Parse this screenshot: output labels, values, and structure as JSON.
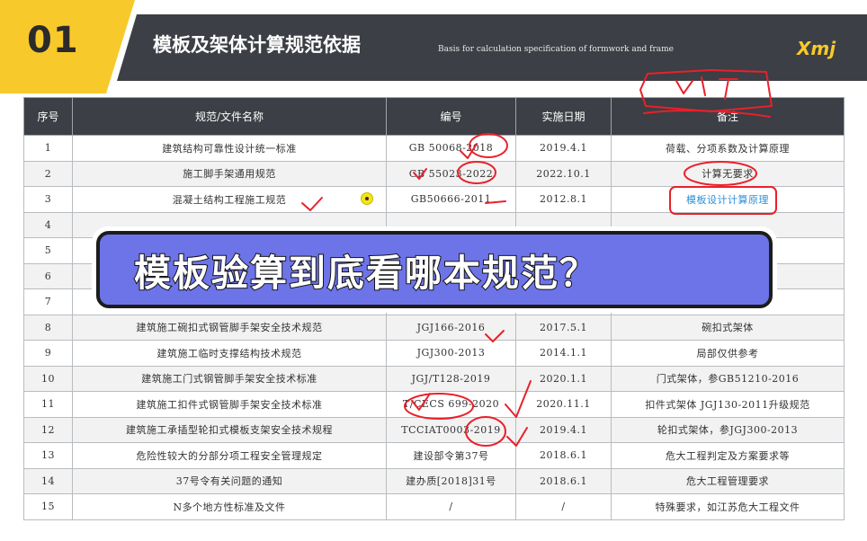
{
  "header": {
    "number": "01",
    "title": "模板及架体计算规范依据",
    "subtitle": "Basis for calculation specification of formwork and frame",
    "brand": "Xmj"
  },
  "table": {
    "columns": [
      "序号",
      "规范/文件名称",
      "编号",
      "实施日期",
      "备注"
    ],
    "rows": [
      {
        "no": "1",
        "name": "建筑结构可靠性设计统一标准",
        "code": "GB 50068-2018",
        "date": "2019.4.1",
        "note": "荷载、分项系数及计算原理"
      },
      {
        "no": "2",
        "name": "施工脚手架通用规范",
        "code": "GB 55023-2022",
        "date": "2022.10.1",
        "note": "计算无要求"
      },
      {
        "no": "3",
        "name": "混凝土结构工程施工规范",
        "code": "GB50666-2011",
        "date": "2012.8.1",
        "note": "模板设计计算原理"
      },
      {
        "no": "4",
        "name": "",
        "code": "",
        "date": "",
        "note": ""
      },
      {
        "no": "5",
        "name": "",
        "code": "",
        "date": "",
        "note": ""
      },
      {
        "no": "6",
        "name": "",
        "code": "",
        "date": "",
        "note": ""
      },
      {
        "no": "7",
        "name": "",
        "code": "",
        "date": "",
        "note": ""
      },
      {
        "no": "8",
        "name": "建筑施工碗扣式钢管脚手架安全技术规范",
        "code": "JGJ166-2016",
        "date": "2017.5.1",
        "note": "碗扣式架体"
      },
      {
        "no": "9",
        "name": "建筑施工临时支撑结构技术规范",
        "code": "JGJ300-2013",
        "date": "2014.1.1",
        "note": "局部仅供参考"
      },
      {
        "no": "10",
        "name": "建筑施工门式钢管脚手架安全技术标准",
        "code": "JGJ/T128-2019",
        "date": "2020.1.1",
        "note": "门式架体，参GB51210-2016"
      },
      {
        "no": "11",
        "name": "建筑施工扣件式钢管脚手架安全技术标准",
        "code": "T/CECS 699-2020",
        "date": "2020.11.1",
        "note": "扣件式架体  JGJ130-2011升级规范"
      },
      {
        "no": "12",
        "name": "建筑施工承插型轮扣式模板支架安全技术规程",
        "code": "TCCIAT0003-2019",
        "date": "2019.4.1",
        "note": "轮扣式架体，参JGJ300-2013"
      },
      {
        "no": "13",
        "name": "危险性较大的分部分项工程安全管理规定",
        "code": "建设部令第37号",
        "date": "2018.6.1",
        "note": "危大工程判定及方案要求等"
      },
      {
        "no": "14",
        "name": "37号令有关问题的通知",
        "code": "建办质[2018]31号",
        "date": "2018.6.1",
        "note": "危大工程管理要求"
      },
      {
        "no": "15",
        "name": "N多个地方性标准及文件",
        "code": "/",
        "date": "/",
        "note": "特殊要求，如江苏危大工程文件"
      }
    ]
  },
  "banner": {
    "text": "模板验算到底看哪本规范？"
  },
  "colors": {
    "accent_yellow": "#f8c92a",
    "header_dark": "#3c3f45",
    "banner_purple": "#6d74e8",
    "annotation_red": "#e8212b",
    "highlight_blue": "#2a8fd8"
  }
}
